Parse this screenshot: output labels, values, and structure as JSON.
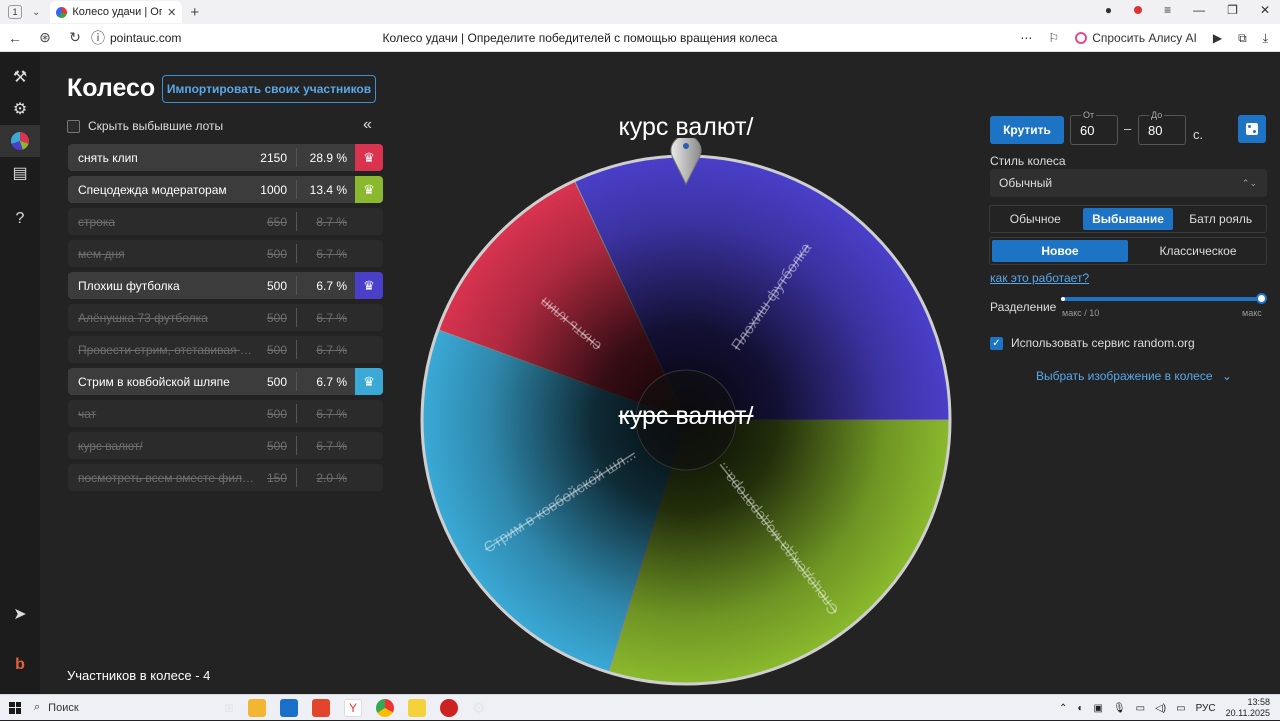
{
  "browser": {
    "tab_number": "1",
    "tab_title": "Колесо удачи | Опреде",
    "url": "pointauc.com",
    "page_title": "Колесо удачи | Определите победителей с помощью вращения колеса",
    "alice_label": "Спросить Алису AI"
  },
  "header": {
    "title": "Колесо",
    "import_label": "Импортировать своих участников",
    "hide_label": "Скрыть выбывшие лоты"
  },
  "lots": [
    {
      "name": "снять клип",
      "amount": "2150",
      "percent": "28.9 %",
      "active": true,
      "color": "#d9334f"
    },
    {
      "name": "Спецодежда модераторам",
      "amount": "1000",
      "percent": "13.4 %",
      "active": true,
      "color": "#8ab92d"
    },
    {
      "name": "строка",
      "amount": "650",
      "percent": "8.7 %",
      "active": false,
      "color": ""
    },
    {
      "name": "мем дня",
      "amount": "500",
      "percent": "6.7 %",
      "active": false,
      "color": ""
    },
    {
      "name": "Плохиш футболка",
      "amount": "500",
      "percent": "6.7 %",
      "active": true,
      "color": "#4a3fc9"
    },
    {
      "name": "Алёнушка 73 футболка",
      "amount": "500",
      "percent": "6.7 %",
      "active": false,
      "color": ""
    },
    {
      "name": "Провести стрим, отставивая поз...",
      "amount": "500",
      "percent": "6.7 %",
      "active": false,
      "color": ""
    },
    {
      "name": "Стрим в ковбойской шляпе",
      "amount": "500",
      "percent": "6.7 %",
      "active": true,
      "color": "#3aa9d6"
    },
    {
      "name": "чат",
      "amount": "500",
      "percent": "6.7 %",
      "active": false,
      "color": ""
    },
    {
      "name": "курс валют/",
      "amount": "500",
      "percent": "6.7 %",
      "active": false,
      "color": ""
    },
    {
      "name": "посмотреть всем вместе фильм ...",
      "amount": "150",
      "percent": "2.0 %",
      "active": false,
      "color": ""
    }
  ],
  "footer": {
    "participants": "Участников в колесе - 4"
  },
  "wheel": {
    "winner_label": "курс валют/",
    "center_label": "курс валют/",
    "segments": [
      {
        "label": "Плохиш футболка",
        "color": "#4a3fc9"
      },
      {
        "label": "Спецодежда модератора...",
        "color": "#8ab92d"
      },
      {
        "label": "Стрим в ковбойской шл...",
        "color": "#3aa9d6"
      },
      {
        "label": "снять клип",
        "color": "#d9334f"
      }
    ]
  },
  "controls": {
    "spin_label": "Крутить",
    "from_label": "От",
    "from_value": "60",
    "to_label": "До",
    "to_value": "80",
    "dash": "–",
    "unit": "с.",
    "style_label": "Стиль колеса",
    "style_value": "Обычный",
    "modes": [
      "Обычное",
      "Выбывание",
      "Батл рояль"
    ],
    "mode_selected": 1,
    "submodes": [
      "Новое",
      "Классическое"
    ],
    "submode_selected": 0,
    "how_link": "как это работает?",
    "split_label": "Разделение",
    "split_min": "макс / 10",
    "split_max": "макс",
    "split_value": 1.0,
    "random_org_label": "Использовать сервис random.org",
    "random_org_checked": true,
    "image_pick_label": "Выбрать изображение в колесе"
  },
  "taskbar": {
    "search": "Поиск",
    "lang": "РУС",
    "time": "13:58",
    "date": "20.11.2025"
  }
}
